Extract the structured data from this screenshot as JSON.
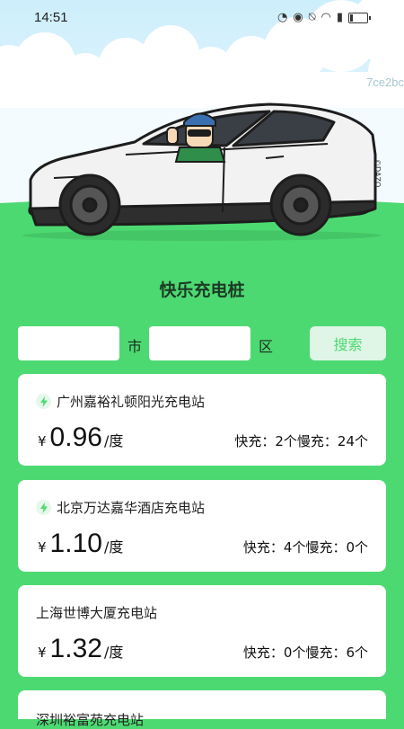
{
  "status_bar": {
    "time": "14:51",
    "icons": [
      "speedometer-icon",
      "eye-icon",
      "mute-icon",
      "wifi-icon",
      "alert-icon",
      "battery-icon"
    ],
    "battery_level": 0.2
  },
  "hero": {
    "watermark": "7ce2bc",
    "car_badge": "©DAZO"
  },
  "page_title": "快乐充电桩",
  "search": {
    "city_value": "",
    "city_unit": "市",
    "district_value": "",
    "district_unit": "区",
    "button_label": "搜索"
  },
  "stations": [
    {
      "name": "广州嘉裕礼顿阳光充电站",
      "has_bolt": true,
      "currency": "¥",
      "price": "0.96",
      "unit": "/度",
      "counts": "快充：2个慢充：24个"
    },
    {
      "name": "北京万达嘉华酒店充电站",
      "has_bolt": true,
      "currency": "¥",
      "price": "1.10",
      "unit": "/度",
      "counts": "快充：4个慢充：0个"
    },
    {
      "name": "上海世博大厦充电站",
      "has_bolt": false,
      "currency": "¥",
      "price": "1.32",
      "unit": "/度",
      "counts": "快充：0个慢充：6个"
    },
    {
      "name": "深圳裕富苑充电站",
      "has_bolt": false,
      "currency": "¥",
      "price": "",
      "unit": "",
      "counts": ""
    }
  ],
  "colors": {
    "accent_green": "#4dd972",
    "button_bg": "#dff5e5",
    "sky": "#cdeefb"
  }
}
